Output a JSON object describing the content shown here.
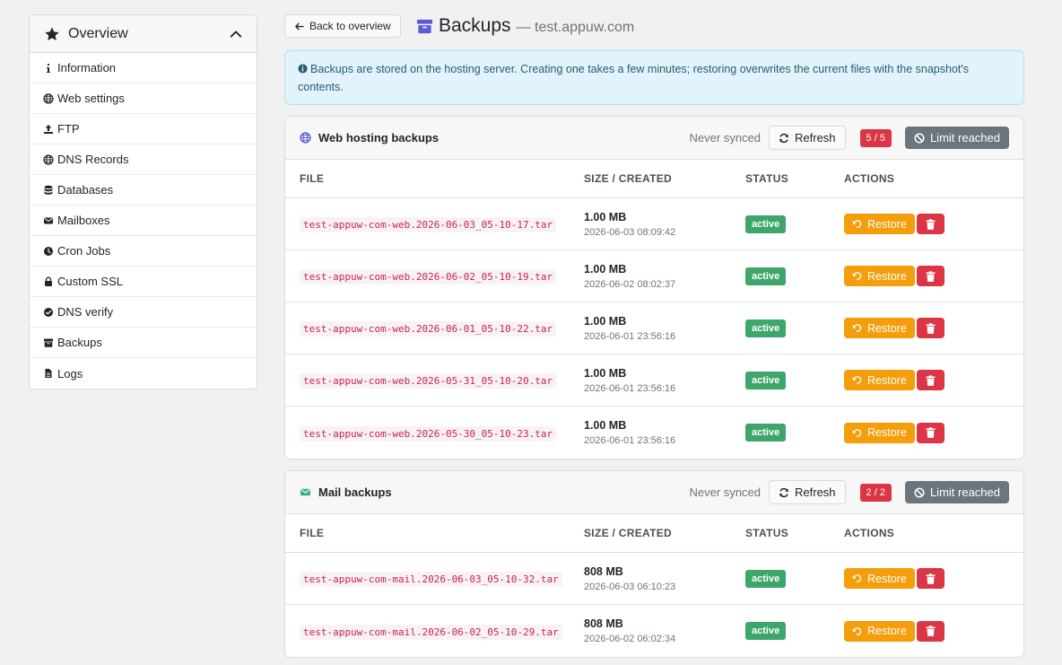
{
  "sidebar": {
    "title": "Overview",
    "items": [
      {
        "label": "Information",
        "icon": "info-icon"
      },
      {
        "label": "Web settings",
        "icon": "globe-icon"
      },
      {
        "label": "FTP",
        "icon": "upload-icon"
      },
      {
        "label": "DNS Records",
        "icon": "globe-icon"
      },
      {
        "label": "Databases",
        "icon": "database-icon"
      },
      {
        "label": "Mailboxes",
        "icon": "envelope-icon"
      },
      {
        "label": "Cron Jobs",
        "icon": "clock-icon"
      },
      {
        "label": "Custom SSL",
        "icon": "lock-icon"
      },
      {
        "label": "DNS verify",
        "icon": "check-circle-icon"
      },
      {
        "label": "Backups",
        "icon": "archive-icon"
      },
      {
        "label": "Logs",
        "icon": "file-icon"
      }
    ]
  },
  "header": {
    "back_label": "Back to overview",
    "title": "Backups",
    "subtitle": "— test.appuw.com"
  },
  "alert": {
    "text": "Backups are stored on the hosting server. Creating one takes a few minutes; restoring overwrites the current files with the snapshot's contents."
  },
  "columns": {
    "file": "FILE",
    "size": "SIZE / CREATED",
    "status": "STATUS",
    "actions": "ACTIONS"
  },
  "web": {
    "title": "Web hosting backups",
    "sync": "Never synced",
    "refresh": "Refresh",
    "count": "5 / 5",
    "limit": "Limit reached",
    "rows": [
      {
        "file": "test-appuw-com-web.2026-06-03_05-10-17.tar",
        "size": "1.00 MB",
        "created": "2026-06-03 08:09:42",
        "status": "active",
        "restore": "Restore"
      },
      {
        "file": "test-appuw-com-web.2026-06-02_05-10-19.tar",
        "size": "1.00 MB",
        "created": "2026-06-02 08:02:37",
        "status": "active",
        "restore": "Restore"
      },
      {
        "file": "test-appuw-com-web.2026-06-01_05-10-22.tar",
        "size": "1.00 MB",
        "created": "2026-06-01 23:56:16",
        "status": "active",
        "restore": "Restore"
      },
      {
        "file": "test-appuw-com-web.2026-05-31_05-10-20.tar",
        "size": "1.00 MB",
        "created": "2026-06-01 23:56:16",
        "status": "active",
        "restore": "Restore"
      },
      {
        "file": "test-appuw-com-web.2026-05-30_05-10-23.tar",
        "size": "1.00 MB",
        "created": "2026-06-01 23:56:16",
        "status": "active",
        "restore": "Restore"
      }
    ]
  },
  "mail": {
    "title": "Mail backups",
    "sync": "Never synced",
    "refresh": "Refresh",
    "count": "2 / 2",
    "limit": "Limit reached",
    "rows": [
      {
        "file": "test-appuw-com-mail.2026-06-03_05-10-32.tar",
        "size": "808 MB",
        "created": "2026-06-03 06:10:23",
        "status": "active",
        "restore": "Restore"
      },
      {
        "file": "test-appuw-com-mail.2026-06-02_05-10-29.tar",
        "size": "808 MB",
        "created": "2026-06-02 06:02:34",
        "status": "active",
        "restore": "Restore"
      }
    ]
  },
  "colors": {
    "accent": "#5b5bd6",
    "mail_accent": "#3fb07a",
    "restore": "#f59e0b",
    "danger": "#dc3545",
    "active": "#3fa66b",
    "muted": "#6c757d"
  }
}
